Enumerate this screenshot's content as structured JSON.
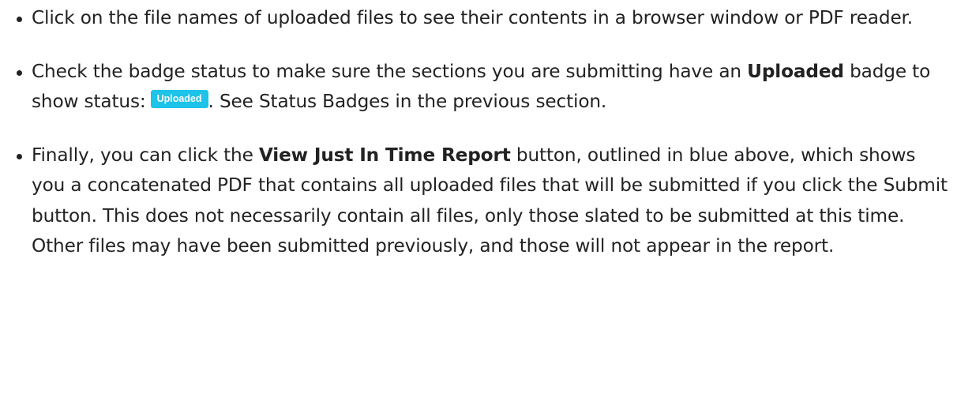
{
  "bullets": [
    {
      "text": "Click on the file names of uploaded files to see their contents in a browser window or PDF reader."
    },
    {
      "text_before": "Check the badge status to make sure the sections you are submitting have an ",
      "bold": "Uploaded",
      "text_middle": " badge to show status:",
      "badge": "Uploaded",
      "text_after": ". See Status Badges in the previous sec­tion."
    },
    {
      "text_before": "Finally, you can click the ",
      "bold": "View Just In Time Report",
      "text_after": " button, outlined in blue above, which shows you a concatenated PDF that contains all uploaded files that will be submitted if you click the Submit button. This does not necessarily contain all files, only those slated to be submitted at this time. Other files may have been submitted previously, and those will not appear in the report."
    }
  ],
  "colors": {
    "text": "#222222",
    "badge_background": "#1dc3e8",
    "badge_text": "#ffffff"
  }
}
